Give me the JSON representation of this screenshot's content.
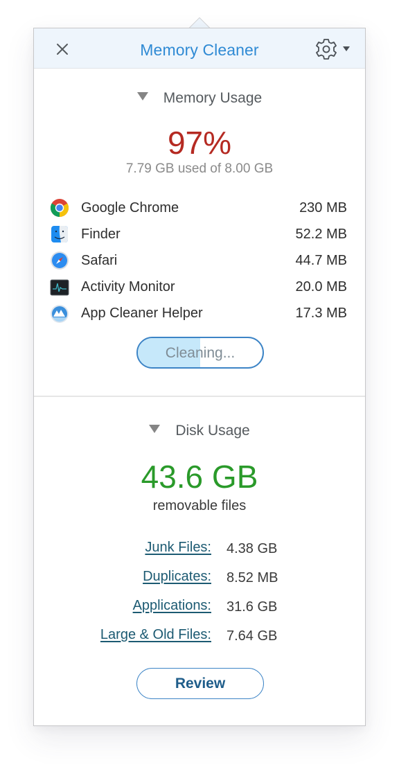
{
  "header": {
    "title": "Memory Cleaner",
    "close_icon": "close-icon",
    "settings_icon": "gear-icon",
    "settings_dropdown_icon": "caret-down-icon",
    "title_color": "#2f8ad4"
  },
  "memory": {
    "section_title": "Memory Usage",
    "percent_used": "97%",
    "usage_text": "7.79 GB used of 8.00 GB",
    "percent_color": "#b52a22",
    "apps": [
      {
        "name": "Google Chrome",
        "size": "230 MB",
        "icon": "chrome-icon"
      },
      {
        "name": "Finder",
        "size": "52.2 MB",
        "icon": "finder-icon"
      },
      {
        "name": "Safari",
        "size": "44.7 MB",
        "icon": "safari-icon"
      },
      {
        "name": "Activity Monitor",
        "size": "20.0 MB",
        "icon": "activity-monitor-icon"
      },
      {
        "name": "App Cleaner Helper",
        "size": "17.3 MB",
        "icon": "app-cleaner-helper-icon"
      }
    ],
    "cleaning_button": {
      "label": "Cleaning...",
      "progress_percent": 50
    }
  },
  "disk": {
    "section_title": "Disk Usage",
    "removable_size": "43.6 GB",
    "removable_label": "removable files",
    "size_color": "#2a9a2a",
    "categories": [
      {
        "label": "Junk Files:",
        "value": "4.38 GB"
      },
      {
        "label": "Duplicates:",
        "value": "8.52 MB"
      },
      {
        "label": "Applications:",
        "value": "31.6 GB"
      },
      {
        "label": "Large & Old Files:",
        "value": "7.64 GB"
      }
    ],
    "review_button": "Review"
  }
}
